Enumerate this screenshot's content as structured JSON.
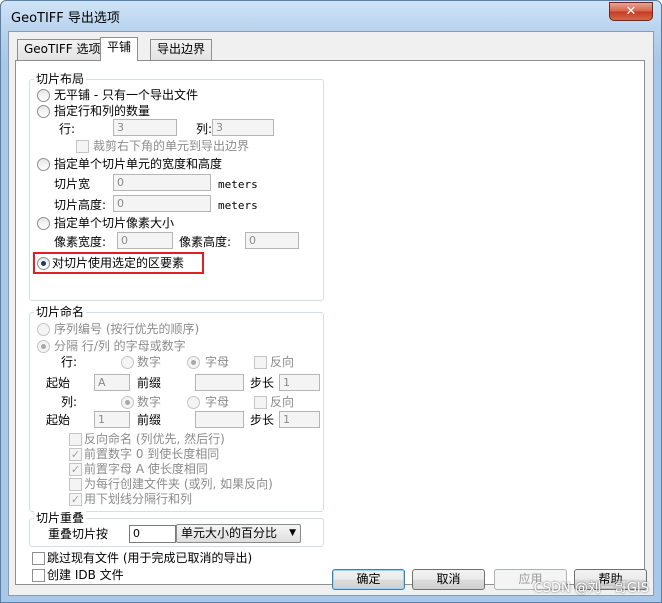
{
  "window": {
    "title": "GeoTIFF 导出选项",
    "close_glyph": "✕"
  },
  "tabs": [
    "GeoTIFF 选项",
    "平铺",
    "导出边界"
  ],
  "layout": {
    "group_label": "切片布局",
    "no_tile": "无平铺 - 只有一个导出文件",
    "rows_cols": "指定行和列的数量",
    "row_label": "行:",
    "row_value": "3",
    "col_label": "列:",
    "col_value": "3",
    "crop": "裁剪右下角的单元到导出边界",
    "cell_size": "指定单个切片单元的宽度和高度",
    "tile_width_label": "切片宽",
    "tile_width_value": "0",
    "tile_height_label": "切片高度:",
    "tile_height_value": "0",
    "unit": "meters",
    "pixel_size": "指定单个切片像素大小",
    "pixel_width_label": "像素宽度:",
    "pixel_width_value": "0",
    "pixel_height_label": "像素高度:",
    "pixel_height_value": "0",
    "use_selected": "对切片使用选定的区要素"
  },
  "naming": {
    "group_label": "切片命名",
    "sequential": "序列编号 (按行优先的顺序)",
    "separate": "分隔 行/列 的字母或数字",
    "row_label": "行:",
    "col_label": "列:",
    "number": "数字",
    "letter": "字母",
    "reverse": "反向",
    "start_label": "起始",
    "row_start": "A",
    "col_start": "1",
    "prefix_label": "前缀",
    "step_label": "步长",
    "row_step": "1",
    "col_step": "1",
    "opt_reverse_naming": "反向命名 (列优先, 然后行)",
    "opt_prefix_number": "前置数字 0 到使长度相同",
    "opt_prefix_letter": "前置字母 A 使长度相同",
    "opt_folder": "为每行创建文件夹 (或列, 如果反向)",
    "opt_underscore": "用下划线分隔行和列"
  },
  "overlap": {
    "group_label": "切片重叠",
    "label": "重叠切片按",
    "value": "0",
    "select": "单元大小的百分比"
  },
  "skip_existing": "跳过现有文件 (用于完成已取消的导出)",
  "create_idb": "创建 IDB 文件",
  "buttons": {
    "ok": "确定",
    "cancel": "取消",
    "apply": "应用",
    "help": "帮助"
  },
  "watermark": "CSDN @刘一哥GIS"
}
